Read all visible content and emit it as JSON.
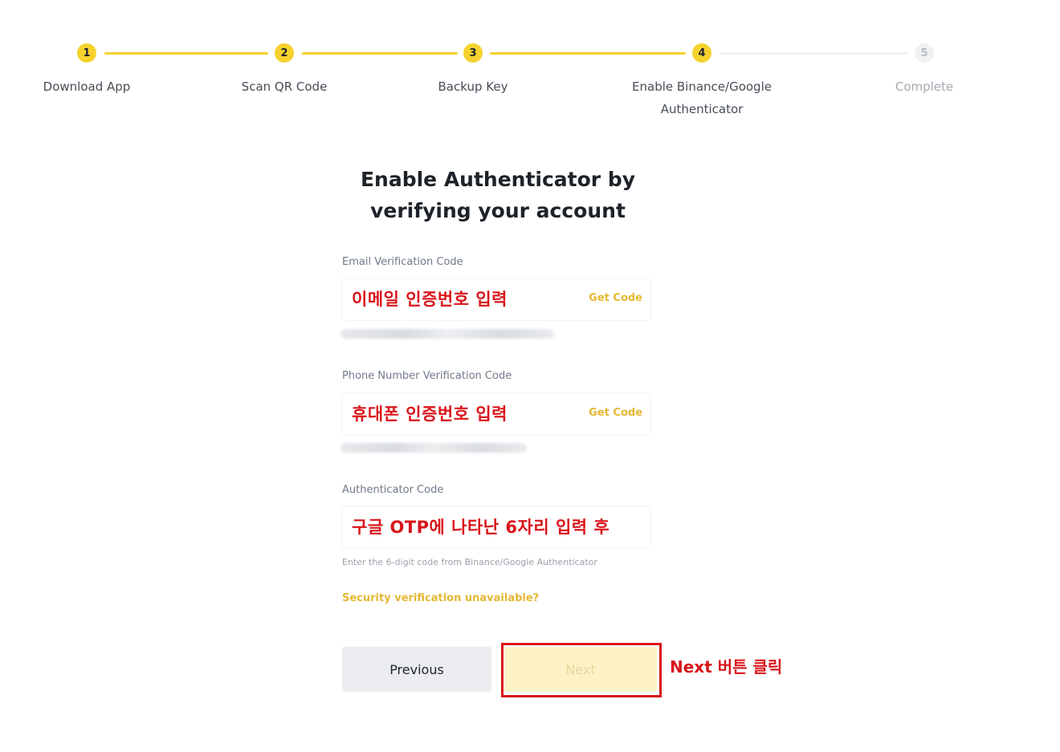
{
  "stepper": {
    "steps": [
      {
        "number": "1",
        "label": "Download App",
        "state": "done"
      },
      {
        "number": "2",
        "label": "Scan QR Code",
        "state": "done"
      },
      {
        "number": "3",
        "label": "Backup Key",
        "state": "done"
      },
      {
        "number": "4",
        "label": "Enable Binance/Google Authenticator",
        "state": "current"
      },
      {
        "number": "5",
        "label": "Complete",
        "state": "todo"
      }
    ]
  },
  "form": {
    "title": "Enable Authenticator by verifying your account",
    "email": {
      "label": "Email Verification Code",
      "value": "이메일 인증번호 입력",
      "get_code": "Get Code"
    },
    "phone": {
      "label": "Phone Number Verification Code",
      "value": "휴대폰 인증번호 입력",
      "get_code": "Get Code"
    },
    "authenticator": {
      "label": "Authenticator Code",
      "value": "구글 OTP에 나타난 6자리 입력 후",
      "hint": "Enter the 6-digit code from Binance/Google Authenticator"
    },
    "security_link": "Security verification unavailable?",
    "previous_label": "Previous",
    "next_label": "Next"
  },
  "annotation": {
    "next_instruction": "Next 버튼 클릭"
  },
  "colors": {
    "accent": "#f5d22e",
    "link": "#e5b832",
    "annotation_red": "#d9151b"
  }
}
